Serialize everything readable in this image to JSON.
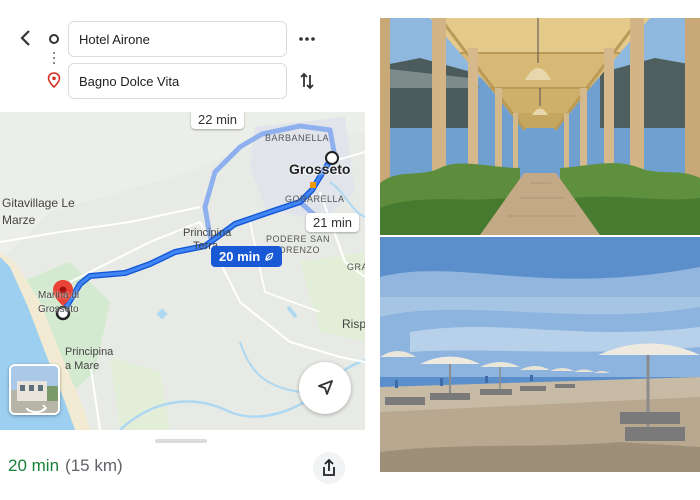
{
  "directions": {
    "origin_value": "Hotel Airone",
    "destination_value": "Bagno Dolce Vita"
  },
  "map": {
    "labels": {
      "barbanella": "BARBANELLA",
      "grosseto": "Grosseto",
      "gorarella": "GORARELLA",
      "gitavillage_line1": "Gitavillage Le",
      "gitavillage_line2": "Marze",
      "principina_terra": "Principina",
      "principina_terra2": "Terra",
      "podere_line1": "PODERE SAN",
      "podere_line2": "LORENZO",
      "marina_line1": "Marina di",
      "marina_line2": "Grosseto",
      "principina_mare1": "Principina",
      "principina_mare2": "a Mare",
      "gra": "GRA",
      "risp": "Risp"
    },
    "alt_route_1_time": "22 min",
    "alt_route_2_time": "21 min",
    "main_route_time": "20 min"
  },
  "summary": {
    "duration": "20 min",
    "distance": "(15 km)"
  },
  "colors": {
    "route": "#1a59d6",
    "alt_route": "#8fb0ee",
    "sea": "#9ccff0",
    "duration": "#188038"
  }
}
